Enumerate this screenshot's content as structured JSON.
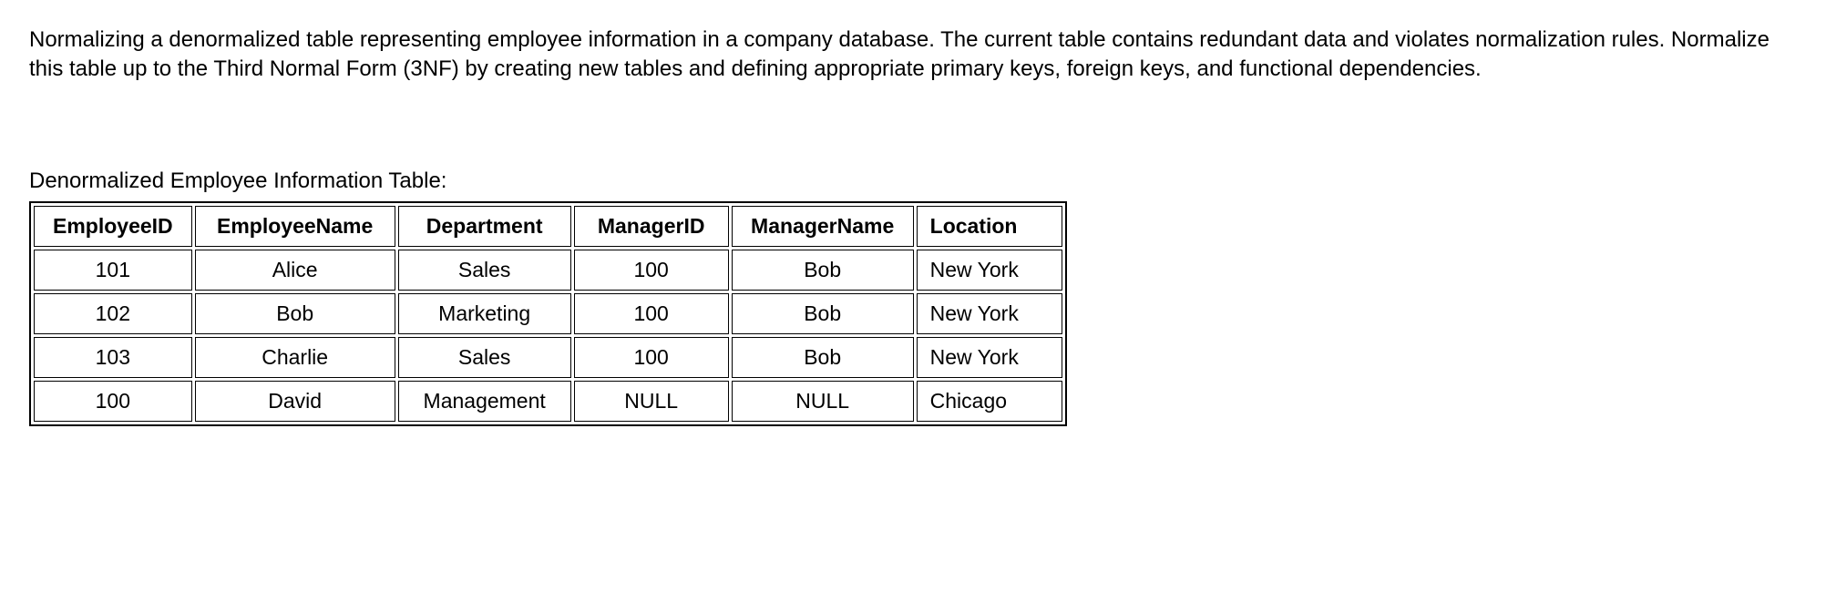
{
  "description": "Normalizing a denormalized table representing employee information in a company database. The current table contains redundant data and violates normalization rules. Normalize this table up to the Third Normal Form (3NF) by creating new tables and defining appropriate primary keys, foreign keys, and functional dependencies.",
  "table_caption": "Denormalized Employee Information Table:",
  "table": {
    "headers": [
      "EmployeeID",
      "EmployeeName",
      "Department",
      "ManagerID",
      "ManagerName",
      "Location"
    ],
    "rows": [
      [
        "101",
        "Alice",
        "Sales",
        "100",
        "Bob",
        "New York"
      ],
      [
        "102",
        "Bob",
        "Marketing",
        "100",
        "Bob",
        "New York"
      ],
      [
        "103",
        "Charlie",
        "Sales",
        "100",
        "Bob",
        "New York"
      ],
      [
        "100",
        "David",
        "Management",
        "NULL",
        "NULL",
        "Chicago"
      ]
    ]
  }
}
